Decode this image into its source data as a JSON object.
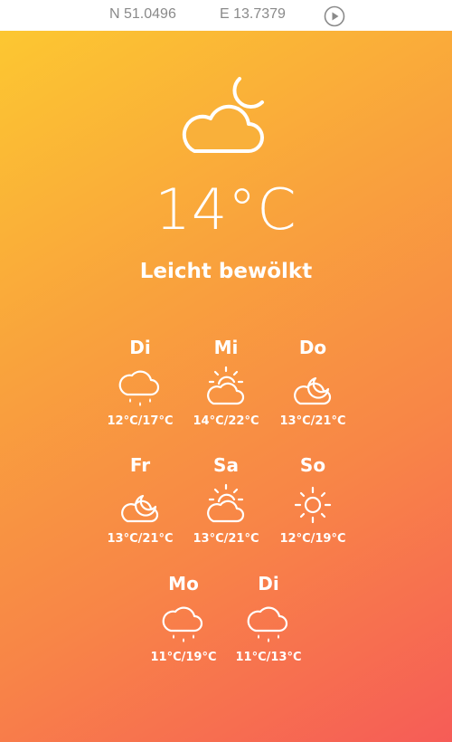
{
  "location": {
    "latitude": "N 51.0496",
    "longitude": "E 13.7379"
  },
  "current": {
    "temperature": "14°C",
    "condition": "Leicht bewölkt",
    "icon": "cloud-moon-icon"
  },
  "forecast": [
    {
      "day": "Di",
      "range": "12°C/17°C",
      "icon": "rain-icon"
    },
    {
      "day": "Mi",
      "range": "14°C/22°C",
      "icon": "cloud-sun-icon"
    },
    {
      "day": "Do",
      "range": "13°C/21°C",
      "icon": "cloud-moon-icon"
    },
    {
      "day": "Fr",
      "range": "13°C/21°C",
      "icon": "cloud-moon-icon"
    },
    {
      "day": "Sa",
      "range": "13°C/21°C",
      "icon": "cloud-sun-icon"
    },
    {
      "day": "So",
      "range": "12°C/19°C",
      "icon": "sun-icon"
    },
    {
      "day": "Mo",
      "range": "11°C/19°C",
      "icon": "rain-icon"
    },
    {
      "day": "Di",
      "range": "11°C/13°C",
      "icon": "rain-icon"
    }
  ],
  "colors": {
    "gradient_start": "#fcc731",
    "gradient_end": "#f65c57",
    "topbar_text": "#8a8a8a",
    "foreground": "#ffffff"
  }
}
